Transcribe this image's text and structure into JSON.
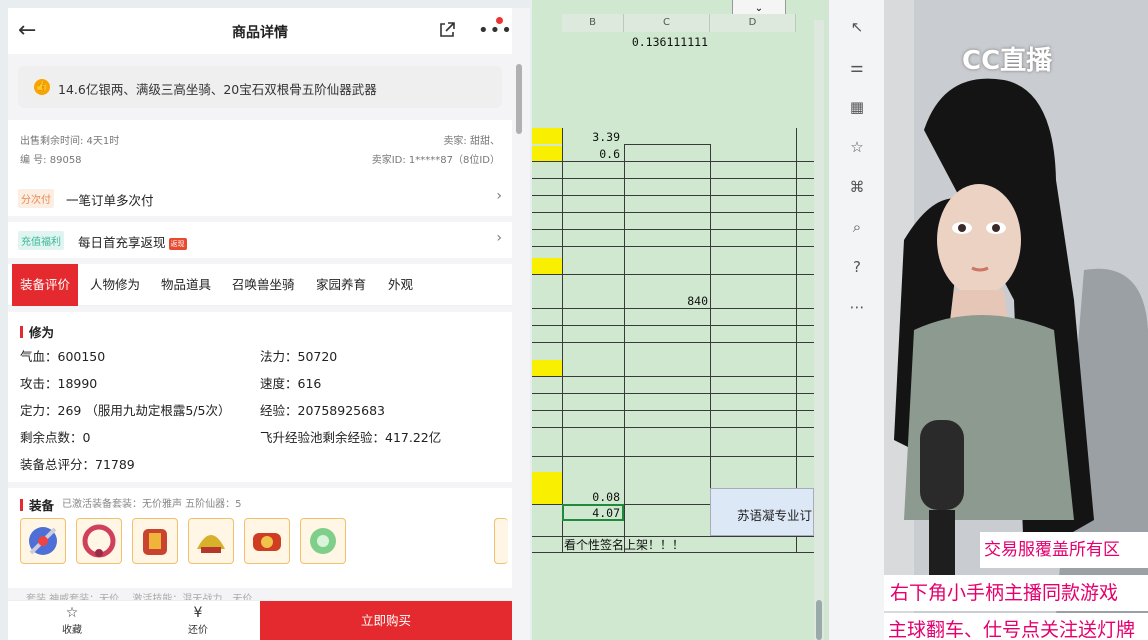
{
  "detail": {
    "title": "商品详情",
    "description": "14.6亿银两、满级三高坐骑、20宝石双根骨五阶仙器武器",
    "sale_time": "出售剩余时间: 4天1时",
    "serial": "编 号: 89058",
    "seller": "卖家: 甜甜、",
    "seller_id": "卖家ID: 1*****87（8位ID）",
    "installment_badge": "分次付",
    "installment_text": "一笔订单多次付",
    "recharge_badge": "充值福利",
    "recharge_text": "每日首充享返现",
    "recharge_tag": "返现",
    "tabs": [
      "装备评价",
      "人物修为",
      "物品道具",
      "召唤兽坐骑",
      "家园养育",
      "外观"
    ],
    "section_cultivation": "修为",
    "stats": {
      "hp": "气血：600150",
      "mp": "法力：50720",
      "atk": "攻击：18990",
      "speed": "速度：616",
      "def": "定力：269 （服用九劫定根露5/5次）",
      "exp": "经验：20758925683",
      "points": "剩余点数：0",
      "ascend_exp": "飞升经验池剩余经验：417.22亿",
      "total_score": "装备总评分：71789"
    },
    "section_equip": "装备",
    "equip_sub": "已激活装备套装：无价雅声   五阶仙器：5",
    "faded_text": "套装   神威套装：无价…  激活技能：混天战力…无价…",
    "collect": "收藏",
    "bargain": "还价",
    "buy": "立即购买"
  },
  "sheet": {
    "columns": [
      "B",
      "C",
      "D"
    ],
    "c1": "0.136111111",
    "b_339": "3.39",
    "b_06": "0.6",
    "c_840": "840",
    "b_008": "0.08",
    "b_407": "4.07",
    "signature": "看个性签名上架！！！",
    "bluebox": "苏语凝专业订",
    "dropdown": "⌄"
  },
  "cam": {
    "logo": "CC直播",
    "ticker1": "交易服覆盖所有区",
    "ticker2": "右下角小手柄主播同款游戏",
    "ticker3": "主球翻车、仕号点关注送灯牌"
  },
  "colors": {
    "accent": "#e42a2f",
    "sheet_bg": "#cfe8cf",
    "highlight": "#f8f000",
    "ticker": "#e5006e"
  }
}
